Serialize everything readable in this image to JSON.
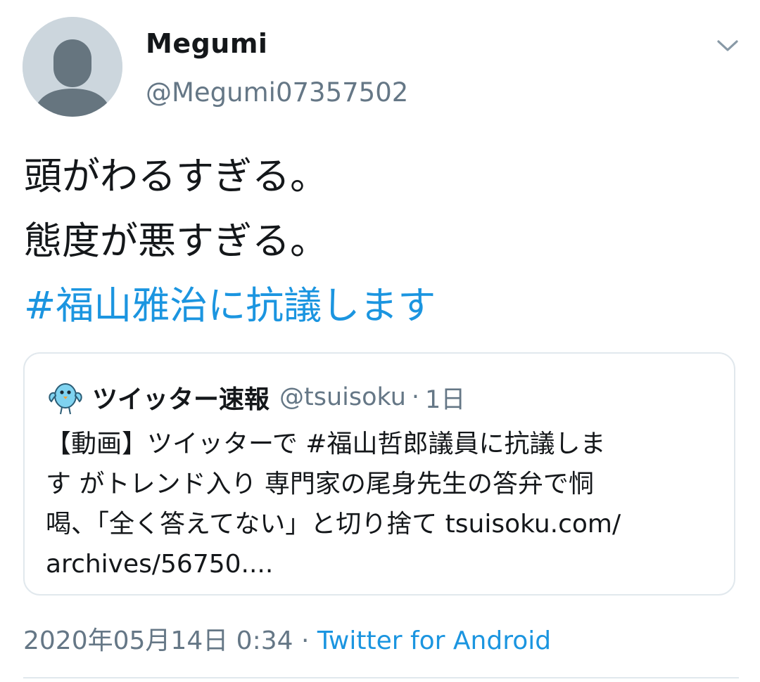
{
  "author": {
    "display_name": "Megumi",
    "handle": "@Megumi07357502",
    "avatar_icon": "default-profile-icon",
    "menu_icon": "chevron-down-icon"
  },
  "tweet": {
    "lines": [
      "頭がわるすぎる。",
      "態度が悪すぎる。"
    ],
    "hashtag": "#福山雅治に抗議します"
  },
  "quoted_tweet": {
    "avatar_icon": "bird-mascot-icon",
    "display_name": "ツイッター速報",
    "handle": "@tsuisoku",
    "separator": "·",
    "time": "1日",
    "body_lines": [
      "【動画】ツイッターで #福山哲郎議員に抗議しま",
      "す がトレンド入り 専門家の尾身先生の答弁で恫",
      "喝、「全く答えてない」と切り捨て tsuisoku.com/",
      "archives/56750...."
    ]
  },
  "meta": {
    "timestamp": "2020年05月14日 0:34",
    "separator": " · ",
    "source": "Twitter for Android"
  },
  "colors": {
    "link": "#1b95e0",
    "secondary_text": "#657786",
    "border": "#e1e8ed"
  }
}
